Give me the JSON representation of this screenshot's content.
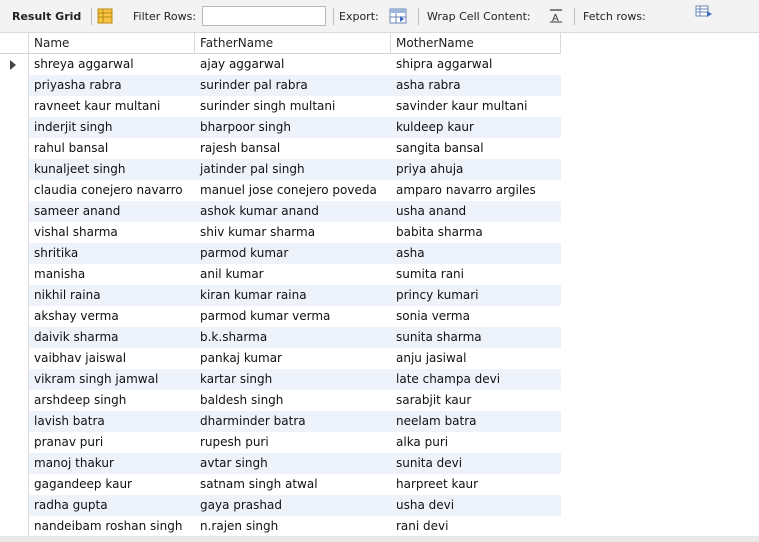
{
  "toolbar": {
    "result_grid": "Result Grid",
    "filter_rows": "Filter Rows:",
    "filter_value": "",
    "export": "Export:",
    "wrap_cell": "Wrap Cell Content:",
    "fetch_rows": "Fetch rows:"
  },
  "grid": {
    "columns": [
      "Name",
      "FatherName",
      "MotherName"
    ],
    "rows": [
      [
        "shreya aggarwal",
        "ajay aggarwal",
        "shipra aggarwal"
      ],
      [
        "priyasha rabra",
        "surinder pal rabra",
        "asha rabra"
      ],
      [
        "ravneet kaur multani",
        "surinder singh multani",
        "savinder kaur multani"
      ],
      [
        "inderjit singh",
        "bharpoor singh",
        "kuldeep kaur"
      ],
      [
        "rahul bansal",
        "rajesh bansal",
        "sangita bansal"
      ],
      [
        "kunaljeet singh",
        "jatinder pal singh",
        "priya ahuja"
      ],
      [
        "claudia conejero navarro",
        "manuel jose conejero poveda",
        "amparo navarro argiles"
      ],
      [
        "sameer anand",
        "ashok kumar anand",
        "usha anand"
      ],
      [
        "vishal sharma",
        "shiv kumar sharma",
        "babita sharma"
      ],
      [
        "shritika",
        "parmod kumar",
        "asha"
      ],
      [
        "manisha",
        "anil kumar",
        "sumita rani"
      ],
      [
        "nikhil raina",
        "kiran kumar raina",
        "princy kumari"
      ],
      [
        "akshay verma",
        "parmod kumar verma",
        "sonia verma"
      ],
      [
        "daivik sharma",
        "b.k.sharma",
        "sunita sharma"
      ],
      [
        "vaibhav jaiswal",
        "pankaj  kumar",
        "anju jasiwal"
      ],
      [
        "vikram singh jamwal",
        "kartar singh",
        "late champa devi"
      ],
      [
        "arshdeep singh",
        "baldesh singh",
        "sarabjit kaur"
      ],
      [
        "lavish batra",
        "dharminder batra",
        "neelam batra"
      ],
      [
        "pranav puri",
        "rupesh puri",
        "alka puri"
      ],
      [
        "manoj thakur",
        "avtar singh",
        "sunita devi"
      ],
      [
        "gagandeep kaur",
        "satnam singh atwal",
        "harpreet kaur"
      ],
      [
        "radha gupta",
        "gaya prashad",
        "usha devi"
      ],
      [
        "nandeibam roshan singh",
        "n.rajen singh",
        "rani devi"
      ]
    ]
  }
}
